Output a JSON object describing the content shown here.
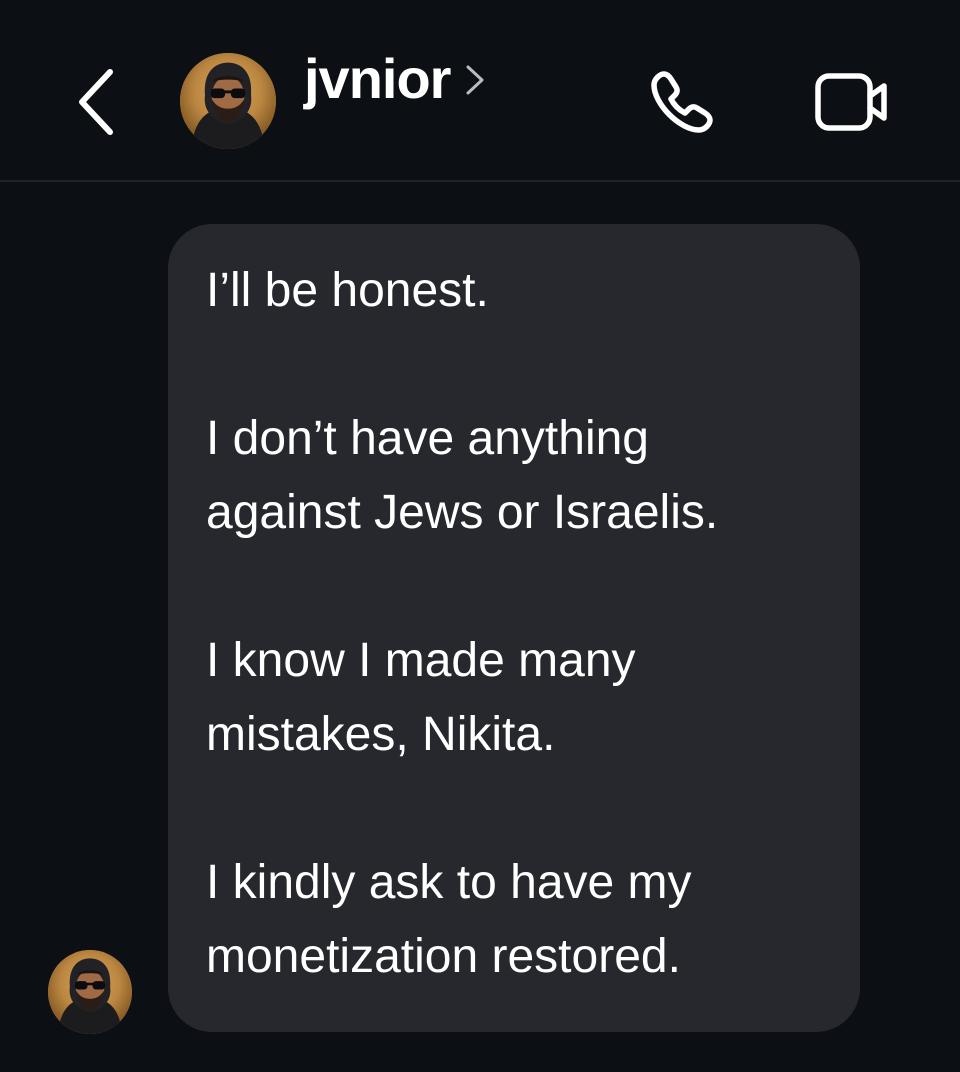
{
  "header": {
    "contact_name": "jvnior",
    "back_icon": "chevron-left-icon",
    "detail_icon": "chevron-right-icon",
    "call_icon": "phone-icon",
    "video_icon": "video-camera-icon"
  },
  "conversation": {
    "messages": [
      {
        "sender": "jvnior",
        "paragraphs": [
          "I’ll be honest.",
          "I don’t have anything\nagainst Jews or Israelis.",
          "I know I made many\nmistakes, Nikita.",
          "I kindly ask to have my\nmonetization restored."
        ]
      }
    ]
  },
  "colors": {
    "background": "#0c0f14",
    "bubble": "#26282e",
    "divider": "#1f232a",
    "text": "#ffffff",
    "muted": "#b8bcc4"
  }
}
